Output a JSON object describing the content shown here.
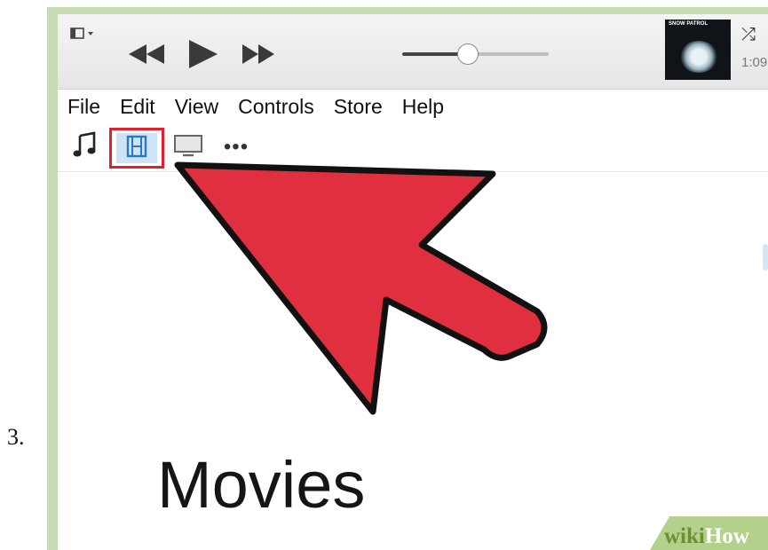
{
  "step": {
    "number": "3."
  },
  "toolbar": {
    "sidebar_toggle_icon": "sidebar-icon",
    "controls": [
      "rewind-icon",
      "play-icon",
      "fast-forward-icon"
    ],
    "volume_level": 0.45,
    "now_playing": {
      "art_text": "SNOW PATROL",
      "time": "1:09"
    },
    "shuffle_icon": "shuffle-icon"
  },
  "menu": {
    "items": [
      "File",
      "Edit",
      "View",
      "Controls",
      "Store",
      "Help"
    ]
  },
  "media_kinds": [
    {
      "icon": "music-note-icon",
      "selected": false
    },
    {
      "icon": "film-icon",
      "selected": true
    },
    {
      "icon": "tv-icon",
      "selected": false
    },
    {
      "icon": "more-icon",
      "glyph": "•••",
      "selected": false
    }
  ],
  "content": {
    "title": "Movies"
  },
  "watermark": {
    "wiki": "wiki",
    "how": "How"
  },
  "colors": {
    "frame_green": "#c7dcb2",
    "highlight_red": "#e0202a",
    "arrow_red": "#e03040",
    "selected_blue": "#cfe3f6"
  }
}
